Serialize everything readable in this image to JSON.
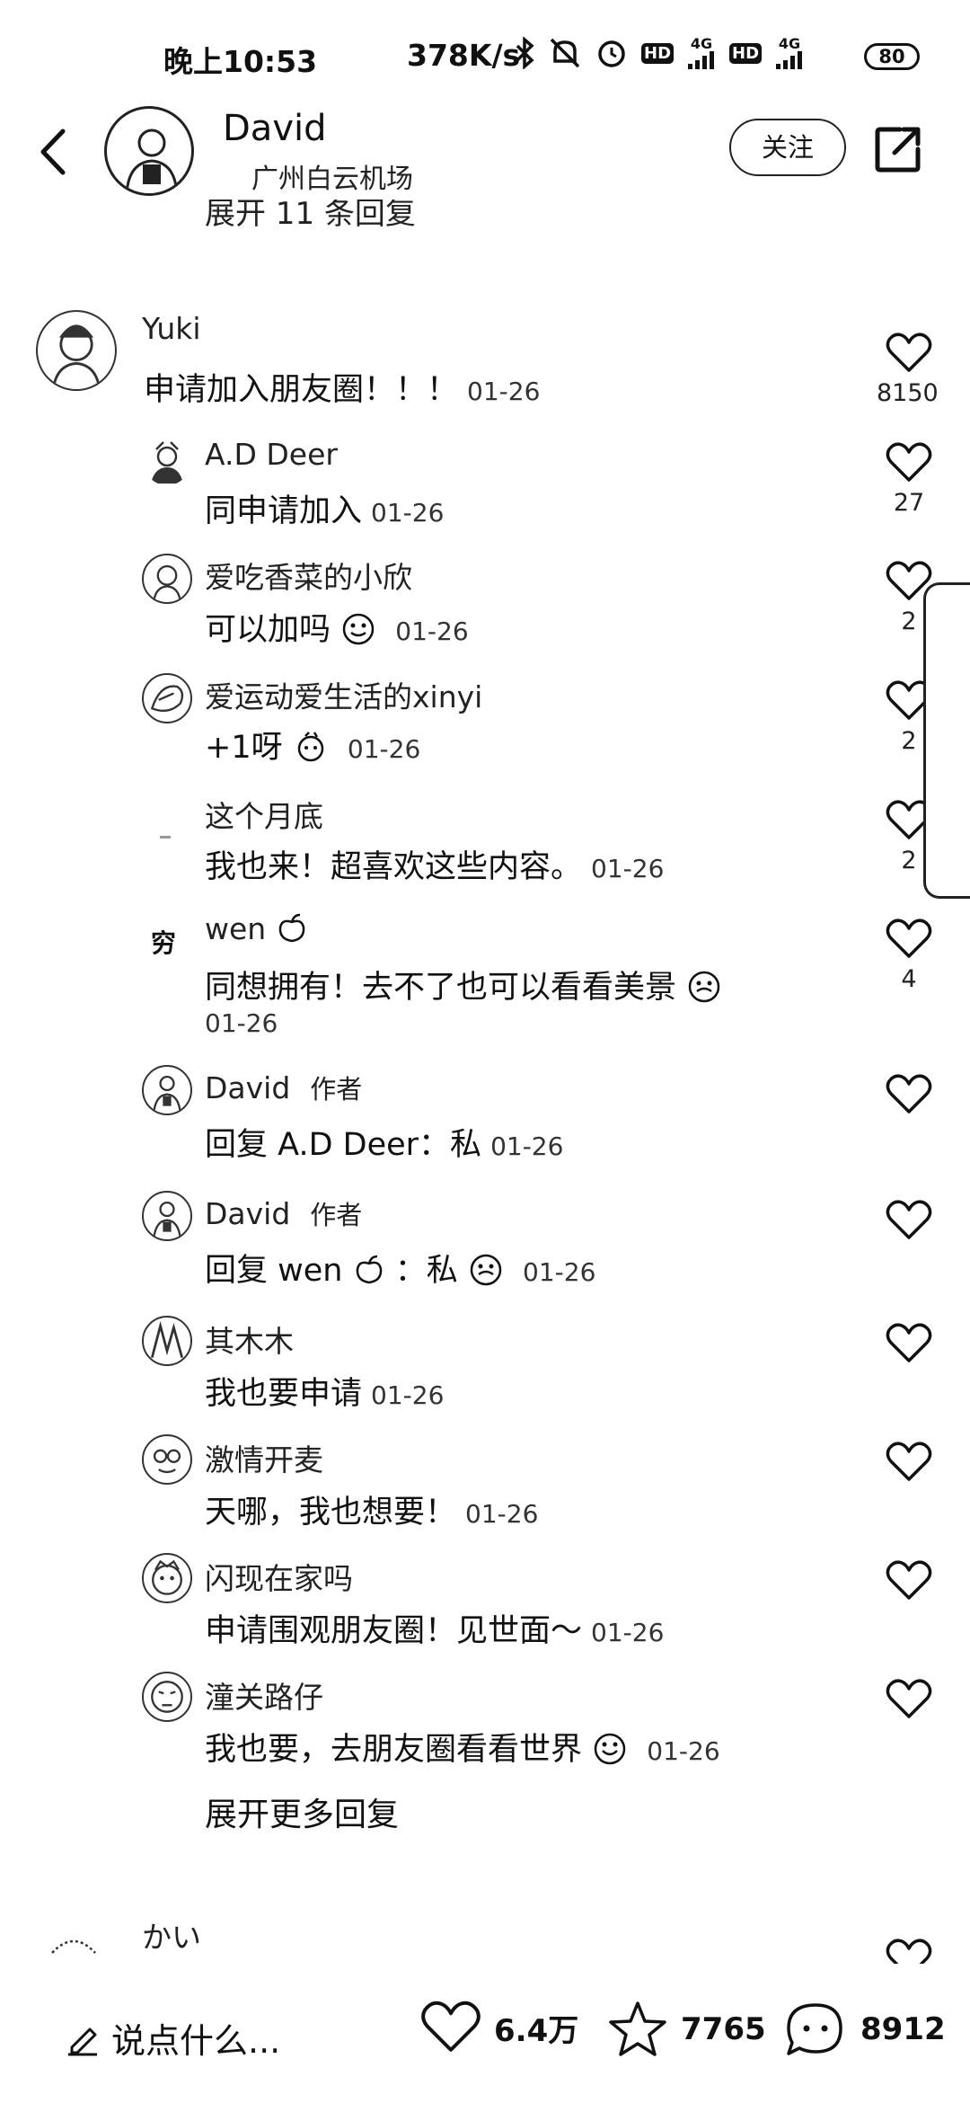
{
  "status_bar": {
    "time": "晚上10:53",
    "speed": "378K/s",
    "net_1": "4G",
    "net_2": "4G",
    "hd": "HD",
    "battery": "80"
  },
  "header": {
    "name": "David",
    "location": "广州白云机场",
    "follow_label": "关注"
  },
  "cut_text": "展开 11 条回复",
  "main_comment": {
    "user": "Yuki",
    "text": "申请加入朋友圈！！！",
    "time": "01-26",
    "likes": "8150"
  },
  "replies": [
    {
      "user": "A.D Deer",
      "text": "同申请加入",
      "time": "01-26",
      "likes": "27"
    },
    {
      "user": "爱吃香菜的小欣",
      "text": "可以加吗",
      "time": "01-26",
      "likes": "2"
    },
    {
      "user": "爱运动爱生活的xinyi",
      "text": "+1呀",
      "time": "01-26",
      "likes": "2"
    },
    {
      "user": "这个月底",
      "text": "我也来！超喜欢这些内容。",
      "time": "01-26",
      "likes": "2"
    },
    {
      "user": "wen",
      "text": "同想拥有！去不了也可以看看美景",
      "time": "01-26",
      "likes": "4"
    },
    {
      "user": "David",
      "tag": "作者",
      "text": "回复  A.D Deer：私",
      "time": "01-26"
    },
    {
      "user": "David",
      "tag": "作者",
      "text": "回复  wen",
      "text_after": "：私",
      "time": "01-26"
    },
    {
      "user": "其木木",
      "text": "我也要申请",
      "time": "01-26"
    },
    {
      "user": "激情开麦",
      "text": "天哪，我也想要！",
      "time": "01-26"
    },
    {
      "user": "闪现在家吗",
      "text": "申请围观朋友圈！见世面～",
      "time": "01-26"
    },
    {
      "user": "潼关路仔",
      "text": "我也要，去朋友圈看看世界",
      "time": "01-26"
    }
  ],
  "avatar_badge_wen": "穷",
  "expand_more": "展开更多回复",
  "next_comment_user": "かい",
  "bottom_bar": {
    "input_placeholder": "说点什么...",
    "likes": "6.4万",
    "favorites": "7765",
    "comments": "8912"
  }
}
